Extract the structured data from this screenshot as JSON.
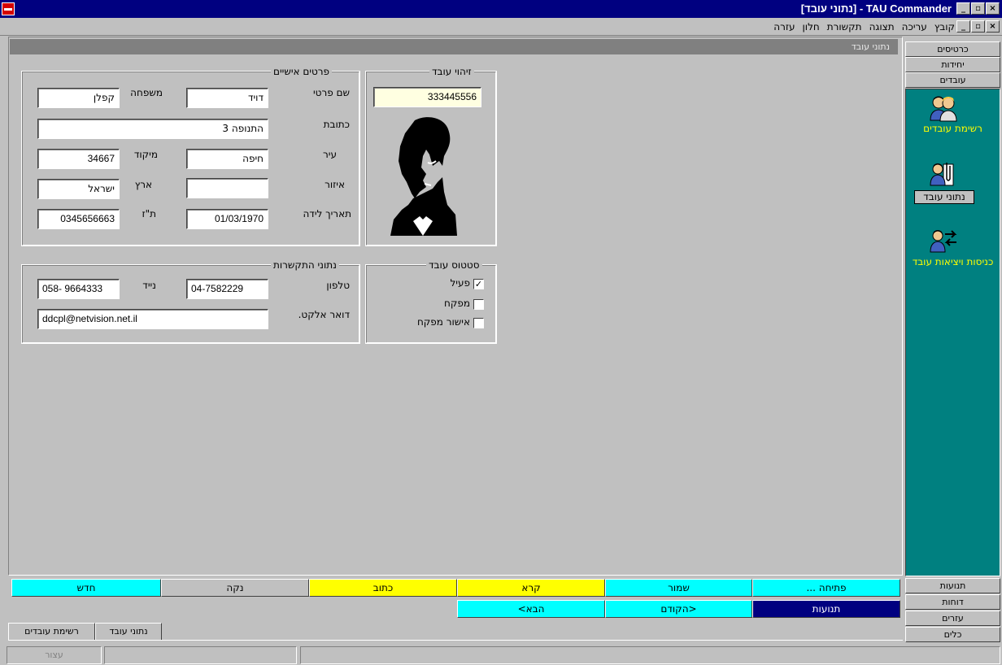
{
  "window": {
    "title": "TAU Commander - [נתוני עובד]",
    "minimize": "_",
    "maximize": "▫",
    "close": "×"
  },
  "menu": {
    "items": [
      "קובץ",
      "עריכה",
      "תצוגה",
      "תקשורת",
      "חלון",
      "עזרה"
    ],
    "mdi_minimize": "_",
    "mdi_restore": "▫",
    "mdi_close": "×"
  },
  "form": {
    "header": "נתוני עובד",
    "personal": {
      "title": "פרטים אישיים",
      "first_name_label": "שם פרטי",
      "first_name": "דויד",
      "last_name_label": "משפחה",
      "last_name": "קפלן",
      "address_label": "כתובת",
      "address": "התנופה 3",
      "city_label": "עיר",
      "city": "חיפה",
      "zip_label": "מיקוד",
      "zip": "34667",
      "region_label": "איזור",
      "region": "",
      "country_label": "ארץ",
      "country": "ישראל",
      "birth_label": "תאריך לידה",
      "birth": "01/03/1970",
      "id_label": "ת\"ז",
      "id": "0345656663"
    },
    "identity": {
      "title": "זיהוי עובד",
      "employee_id": "333445556"
    },
    "contact": {
      "title": "נתוני התקשרות",
      "phone_label": "טלפון",
      "phone": "04-7582229",
      "mobile_label": "נייד",
      "mobile": "058- 9664333",
      "email_label": "דואר אלקט.",
      "email": "ddcpl@netvision.net.il"
    },
    "status": {
      "title": "סטטוס עובד",
      "active_label": "פעיל",
      "active": true,
      "inspector_label": "מפקח",
      "inspector": false,
      "approval_label": "אישור מפקח",
      "approval": false,
      "check_mark": "✓"
    }
  },
  "buttons": {
    "row1": [
      "פתיחה ...",
      "שמור",
      "קרא",
      "כתוב",
      "נקה",
      "חדש"
    ],
    "row2": [
      "תנועות",
      "<הקודם",
      "הבא>"
    ]
  },
  "tabs": [
    "נתוני עובד",
    "רשימת עובדים"
  ],
  "sidebar": {
    "top": [
      "כרטיסים",
      "יחידות",
      "עובדים"
    ],
    "items": [
      "רשימת עובדים",
      "נתוני עובד",
      "כניסות ויציאות עובד"
    ],
    "bottom": [
      "תנועות",
      "דוחות",
      "עזרים",
      "כלים"
    ]
  },
  "status_bar": {
    "cell1": "עצור"
  },
  "colors": {
    "cyan": "#00ffff",
    "yellow": "#ffff00",
    "navy": "#000080",
    "teal": "#008080",
    "sidebar_text": "#ffff00"
  }
}
